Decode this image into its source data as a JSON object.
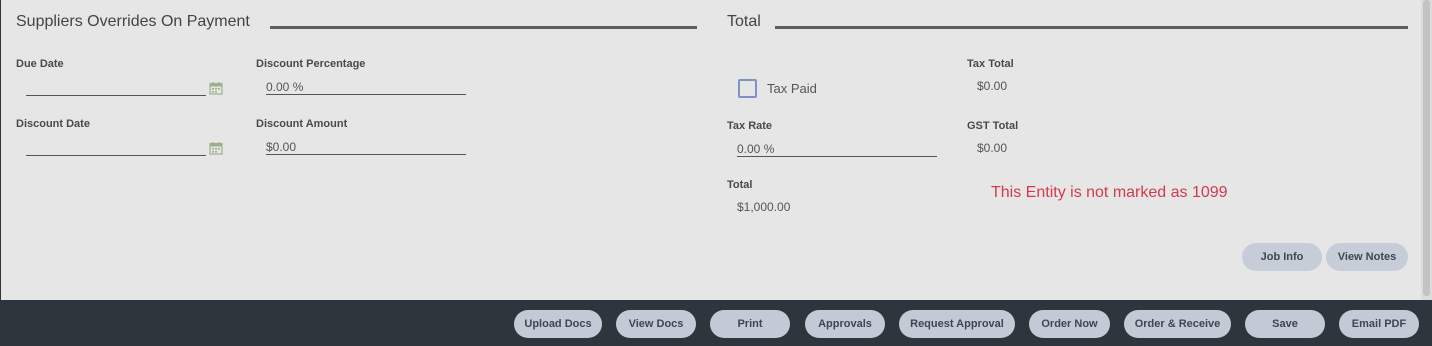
{
  "suppliers": {
    "title": "Suppliers Overrides On Payment",
    "due_date": {
      "label": "Due Date",
      "value": ""
    },
    "discount_date": {
      "label": "Discount Date",
      "value": ""
    },
    "discount_percentage": {
      "label": "Discount Percentage",
      "value": "0.00 %"
    },
    "discount_amount": {
      "label": "Discount Amount",
      "value": "$0.00"
    }
  },
  "total_section": {
    "title": "Total",
    "tax_paid": {
      "label": "Tax Paid",
      "checked": false
    },
    "tax_rate": {
      "label": "Tax Rate",
      "value": "0.00 %"
    },
    "total": {
      "label": "Total",
      "value": "$1,000.00"
    },
    "tax_total": {
      "label": "Tax Total",
      "value": "$0.00"
    },
    "gst_total": {
      "label": "GST Total",
      "value": "$0.00"
    },
    "warning": "This Entity is not marked as 1099"
  },
  "panel_buttons": {
    "job_info": "Job Info",
    "view_notes": "View Notes"
  },
  "footer_buttons": {
    "upload_docs": "Upload Docs",
    "view_docs": "View Docs",
    "print": "Print",
    "approvals": "Approvals",
    "request_approval": "Request Approval",
    "order_now": "Order Now",
    "order_receive": "Order & Receive",
    "save": "Save",
    "email_pdf": "Email PDF"
  },
  "colors": {
    "panel_bg": "#e6e6e6",
    "footer_bg": "#2f353c",
    "button_bg": "#c3cad6",
    "warning_text": "#d33a4b",
    "checkbox_border": "#7d93c8",
    "calendar_icon": "#9db08a"
  },
  "icons": [
    "calendar-icon",
    "checkbox"
  ]
}
